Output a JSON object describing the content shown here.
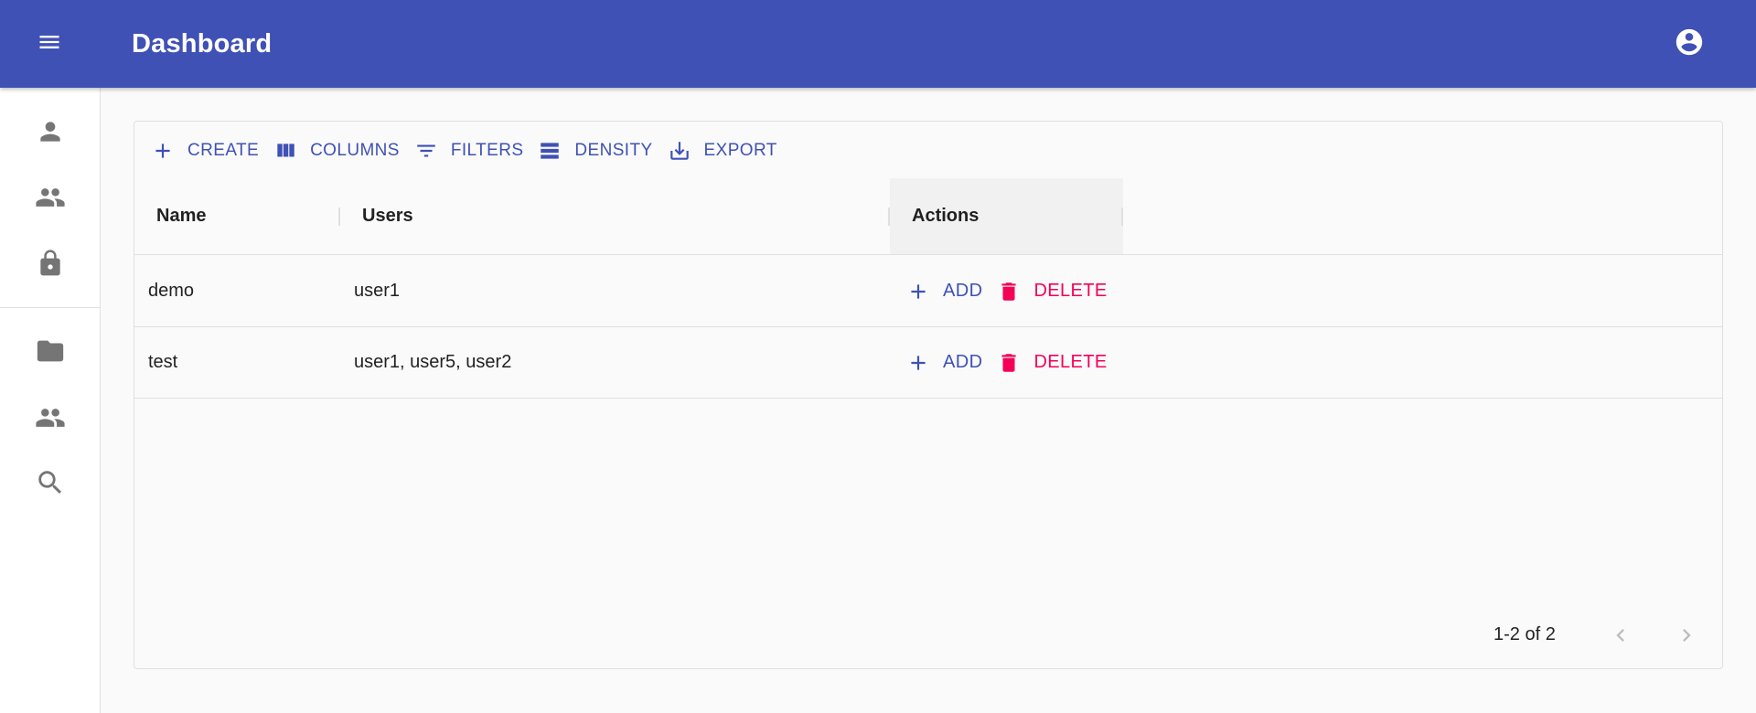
{
  "app_bar": {
    "title": "Dashboard",
    "menu_icon": "menu-icon",
    "account_icon": "account-circle-icon",
    "color": "#3f51b5"
  },
  "sidebar": {
    "items": [
      {
        "icon": "person-icon"
      },
      {
        "icon": "people-icon"
      },
      {
        "icon": "lock-icon"
      },
      {
        "icon": "folder-icon"
      },
      {
        "icon": "people-icon"
      },
      {
        "icon": "search-icon"
      }
    ]
  },
  "toolbar": {
    "create_label": "Create",
    "columns_label": "Columns",
    "filters_label": "Filters",
    "density_label": "Density",
    "export_label": "Export"
  },
  "table": {
    "columns": [
      "Name",
      "Users",
      "Actions"
    ],
    "rows": [
      {
        "name": "demo",
        "users": "user1"
      },
      {
        "name": "test",
        "users": "user1, user5, user2"
      }
    ],
    "add_label": "Add",
    "delete_label": "Delete"
  },
  "pagination": {
    "info": "1-2 of 2"
  },
  "colors": {
    "primary": "#3f51b5",
    "danger": "#f50057"
  }
}
